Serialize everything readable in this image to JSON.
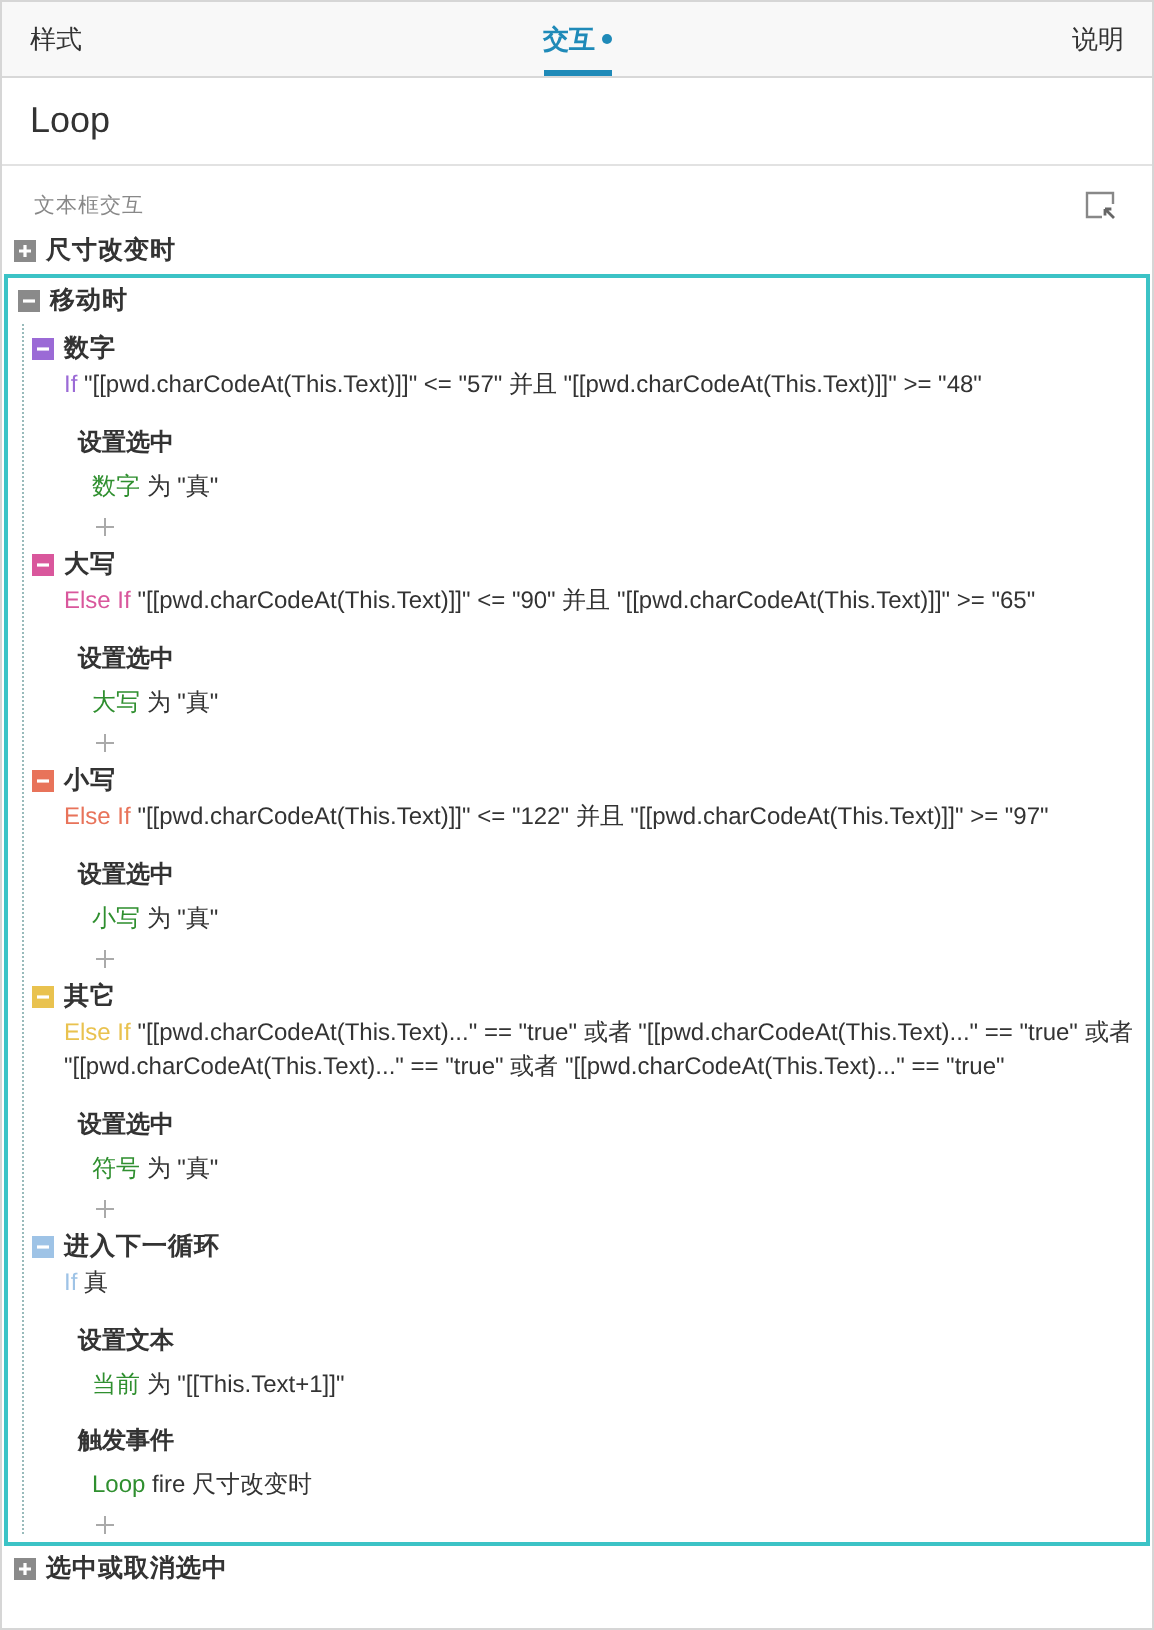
{
  "tabs": [
    {
      "label": "样式",
      "selected": false,
      "dot": false
    },
    {
      "label": "交互",
      "selected": true,
      "dot": true
    },
    {
      "label": "说明",
      "selected": false,
      "dot": false
    }
  ],
  "widget_name": "Loop",
  "section_label": "文本框交互",
  "events": [
    {
      "name": "尺寸改变时",
      "expanded": false,
      "selected": false
    },
    {
      "name": "移动时",
      "expanded": true,
      "selected": true,
      "cases": [
        {
          "name": "数字",
          "color": "#9b6ad6",
          "keyword": "If",
          "condition": "\"[[pwd.charCodeAt(This.Text)]]\" <= \"57\" 并且 \"[[pwd.charCodeAt(This.Text)]]\" >= \"48\"",
          "actions": [
            {
              "name": "设置选中",
              "target": "数字",
              "detail": "为 \"真\""
            }
          ]
        },
        {
          "name": "大写",
          "color": "#d9579c",
          "keyword": "Else If",
          "condition": "\"[[pwd.charCodeAt(This.Text)]]\" <= \"90\" 并且 \"[[pwd.charCodeAt(This.Text)]]\" >= \"65\"",
          "actions": [
            {
              "name": "设置选中",
              "target": "大写",
              "detail": "为 \"真\""
            }
          ]
        },
        {
          "name": "小写",
          "color": "#e8735a",
          "keyword": "Else If",
          "condition": "\"[[pwd.charCodeAt(This.Text)]]\" <= \"122\" 并且 \"[[pwd.charCodeAt(This.Text)]]\" >= \"97\"",
          "actions": [
            {
              "name": "设置选中",
              "target": "小写",
              "detail": "为 \"真\""
            }
          ]
        },
        {
          "name": "其它",
          "color": "#e9c24f",
          "keyword": "Else If",
          "condition": "\"[[pwd.charCodeAt(This.Text)...\" == \"true\" 或者 \"[[pwd.charCodeAt(This.Text)...\" == \"true\" 或者 \"[[pwd.charCodeAt(This.Text)...\" == \"true\" 或者 \"[[pwd.charCodeAt(This.Text)...\" == \"true\"",
          "actions": [
            {
              "name": "设置选中",
              "target": "符号",
              "detail": "为 \"真\""
            }
          ]
        },
        {
          "name": "进入下一循环",
          "color": "#9ec3e6",
          "keyword": "If",
          "condition": "真",
          "actions": [
            {
              "name": "设置文本",
              "target": "当前",
              "detail": "为 \"[[This.Text+1]]\""
            },
            {
              "name": "触发事件",
              "target": "Loop",
              "detail": "fire 尺寸改变时"
            }
          ]
        }
      ]
    },
    {
      "name": "选中或取消选中",
      "expanded": false,
      "selected": false
    }
  ]
}
